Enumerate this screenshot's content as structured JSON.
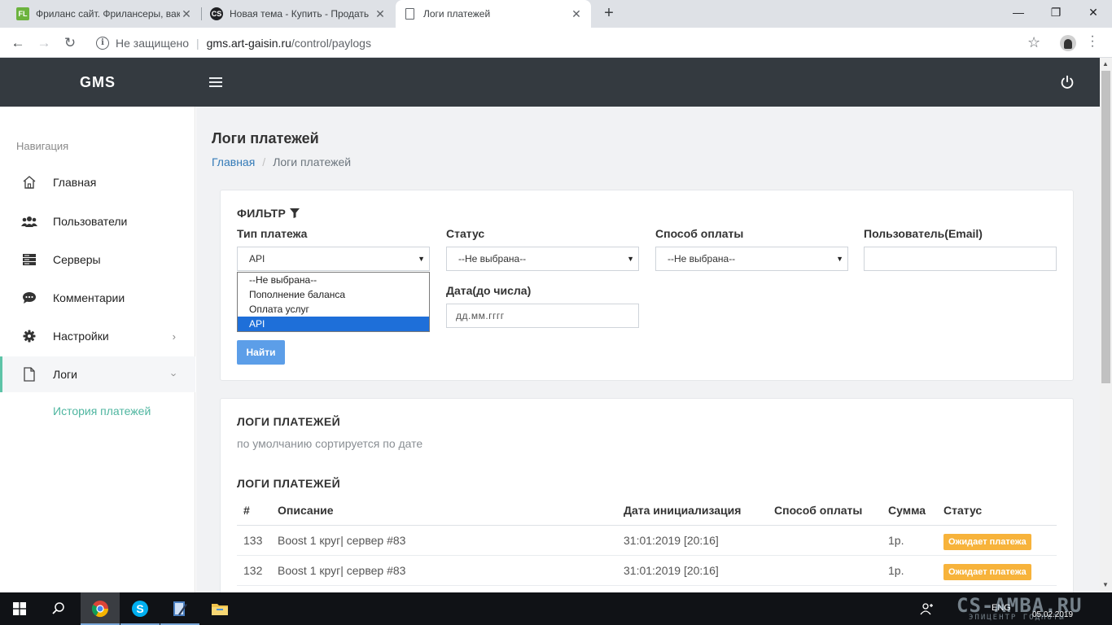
{
  "browser": {
    "tabs": [
      {
        "title": "Фриланс сайт. Фрилансеры, вак",
        "icon": "fl-favicon"
      },
      {
        "title": "Новая тема - Купить - Продать",
        "icon": "cs-favicon"
      },
      {
        "title": "Логи платежей",
        "icon": "document-icon"
      }
    ],
    "security_label": "Не защищено",
    "url_host": "gms.art-gaisin.ru",
    "url_path": "/control/paylogs"
  },
  "app": {
    "brand": "GMS"
  },
  "sidebar": {
    "header": "Навигация",
    "items": [
      {
        "label": "Главная",
        "icon": "home-icon"
      },
      {
        "label": "Пользователи",
        "icon": "users-icon"
      },
      {
        "label": "Серверы",
        "icon": "servers-icon"
      },
      {
        "label": "Комментарии",
        "icon": "comment-icon"
      },
      {
        "label": "Настройки",
        "icon": "gear-icon"
      },
      {
        "label": "Логи",
        "icon": "file-icon"
      }
    ],
    "sub_item": "История платежей"
  },
  "page": {
    "title": "Логи платежей",
    "breadcrumb_home": "Главная",
    "breadcrumb_sep": "/",
    "breadcrumb_current": "Логи платежей"
  },
  "filter": {
    "title": "ФИЛЬТР",
    "payment_type_label": "Тип платежа",
    "payment_type_value": "API",
    "payment_type_options": [
      "--Не выбрана--",
      "Пополнение баланса",
      "Оплата услуг",
      "API"
    ],
    "status_label": "Статус",
    "status_value": "--Не выбрана--",
    "method_label": "Способ оплаты",
    "method_value": "--Не выбрана--",
    "user_label": "Пользователь(Email)",
    "user_value": "",
    "date_label": "Дата(до числа)",
    "date_placeholder": "дд.мм.гггг",
    "search_button": "Найти"
  },
  "logs": {
    "title": "ЛОГИ ПЛАТЕЖЕЙ",
    "subtitle": "по умолчанию сортируется по дате",
    "table_title": "ЛОГИ ПЛАТЕЖЕЙ",
    "columns": [
      "#",
      "Описание",
      "Дата инициализация",
      "Способ оплаты",
      "Сумма",
      "Статус"
    ],
    "rows": [
      {
        "id": "133",
        "description": "Boost 1 круг| сервер #83",
        "date": "31:01:2019 [20:16]",
        "method": "",
        "amount": "1р.",
        "status": "Ожидает платежа"
      },
      {
        "id": "132",
        "description": "Boost 1 круг| сервер #83",
        "date": "31:01:2019 [20:16]",
        "method": "",
        "amount": "1р.",
        "status": "Ожидает платежа"
      }
    ],
    "status_color": "#f7b33b"
  },
  "taskbar": {
    "language": "ENG",
    "date": "05.02.2019",
    "watermark": "CS-AMBA.RU",
    "watermark_sub": "ЭПИЦЕНТР ГОДНОТЫ"
  },
  "colors": {
    "header_bg": "#343a40",
    "accent": "#5ec4a8",
    "link": "#337ab7",
    "primary_button": "#5c9ee8"
  }
}
